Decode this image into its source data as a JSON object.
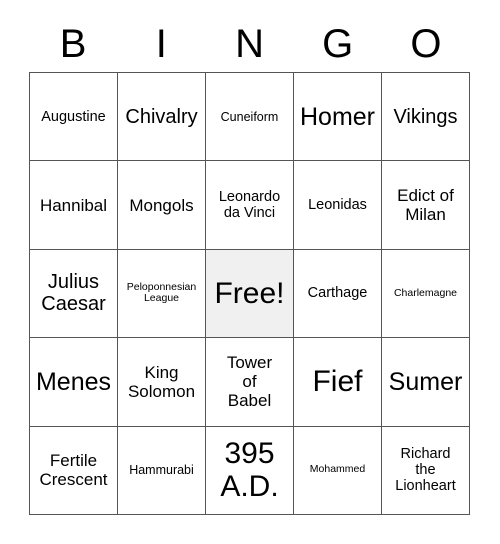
{
  "card": {
    "header": {
      "letters": [
        "B",
        "I",
        "N",
        "G",
        "O"
      ]
    },
    "free_cell": {
      "label": "Free!",
      "background_color": "#f0f0f0",
      "row": 3,
      "column": 3
    },
    "colors": {
      "background": "#ffffff",
      "text": "#000000",
      "grid_line": "#555555",
      "free_square": "#f0f0f0"
    },
    "rows": [
      [
        {
          "label": "Augustine",
          "size": "md"
        },
        {
          "label": "Chivalry",
          "size": "xl"
        },
        {
          "label": "Cuneiform",
          "size": "sm"
        },
        {
          "label": "Homer",
          "size": "xxl"
        },
        {
          "label": "Vikings",
          "size": "xl"
        }
      ],
      [
        {
          "label": "Hannibal",
          "size": "lg"
        },
        {
          "label": "Mongols",
          "size": "lg"
        },
        {
          "label": "Leonardo\nda Vinci",
          "size": "md"
        },
        {
          "label": "Leonidas",
          "size": "md"
        },
        {
          "label": "Edict of\nMilan",
          "size": "lg"
        }
      ],
      [
        {
          "label": "Julius\nCaesar",
          "size": "xl"
        },
        {
          "label": "Peloponnesian\nLeague",
          "size": "xs"
        },
        {
          "label": "Free!",
          "size": "huge",
          "free": true
        },
        {
          "label": "Carthage",
          "size": "md"
        },
        {
          "label": "Charlemagne",
          "size": "xs"
        }
      ],
      [
        {
          "label": "Menes",
          "size": "xxl"
        },
        {
          "label": "King\nSolomon",
          "size": "lg"
        },
        {
          "label": "Tower\nof\nBabel",
          "size": "lg"
        },
        {
          "label": "Fief",
          "size": "huge"
        },
        {
          "label": "Sumer",
          "size": "xxl"
        }
      ],
      [
        {
          "label": "Fertile\nCrescent",
          "size": "lg"
        },
        {
          "label": "Hammurabi",
          "size": "sm"
        },
        {
          "label": "395\nA.D.",
          "size": "huge"
        },
        {
          "label": "Mohammed",
          "size": "xs"
        },
        {
          "label": "Richard\nthe\nLionheart",
          "size": "md"
        }
      ]
    ]
  }
}
